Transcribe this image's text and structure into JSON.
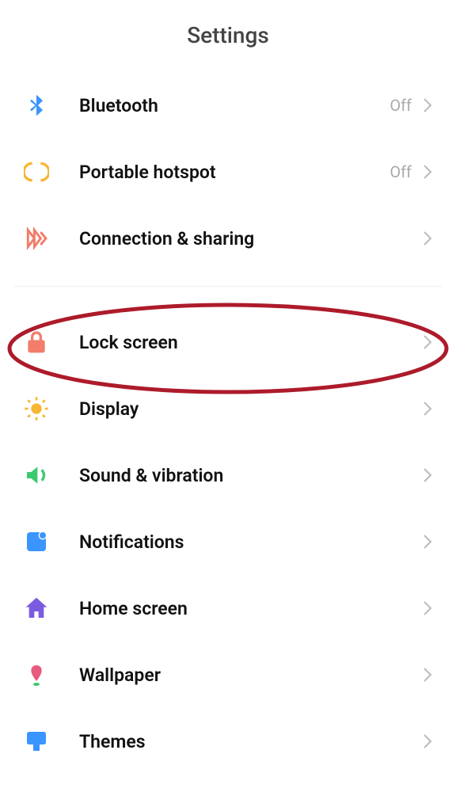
{
  "header": {
    "title": "Settings"
  },
  "group1": [
    {
      "label": "Bluetooth",
      "status": "Off",
      "icon": "bluetooth",
      "color": "#3a95ff"
    },
    {
      "label": "Portable hotspot",
      "status": "Off",
      "icon": "hotspot",
      "color": "#f7b733"
    },
    {
      "label": "Connection & sharing",
      "status": "",
      "icon": "share",
      "color": "#f27d6b"
    }
  ],
  "group2": [
    {
      "label": "Lock screen",
      "status": "",
      "icon": "lock",
      "color": "#f27d6b"
    },
    {
      "label": "Display",
      "status": "",
      "icon": "sun",
      "color": "#f7b733"
    },
    {
      "label": "Sound & vibration",
      "status": "",
      "icon": "sound",
      "color": "#3cc96e"
    },
    {
      "label": "Notifications",
      "status": "",
      "icon": "notifications",
      "color": "#3a95ff"
    },
    {
      "label": "Home screen",
      "status": "",
      "icon": "home",
      "color": "#7b5ce0"
    },
    {
      "label": "Wallpaper",
      "status": "",
      "icon": "wallpaper",
      "color": "#e85a7e"
    },
    {
      "label": "Themes",
      "status": "",
      "icon": "themes",
      "color": "#3a95ff"
    }
  ],
  "annotation": {
    "highlighted_item": "Lock screen",
    "stroke": "#AD1B2B"
  }
}
